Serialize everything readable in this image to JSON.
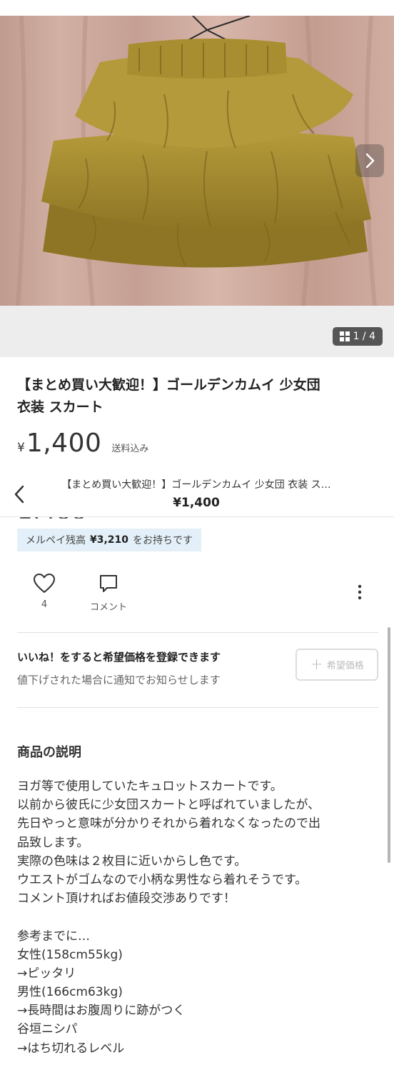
{
  "photo": {
    "counter": "1 / 4",
    "next_icon": "chevron-right-icon",
    "gallery_icon": "grid-icon"
  },
  "item": {
    "title_line1": "【まとめ買い大歓迎！】ゴールデンカムイ 少女団",
    "title_line2": "衣装 スカート",
    "currency": "¥",
    "price": "1,400",
    "shipping": "送料込み"
  },
  "sticky_header": {
    "title": "【まとめ買い大歓迎！】ゴールデンカムイ 少女団 衣装 ス…",
    "price": "¥1,400",
    "back_icon": "chevron-left-icon"
  },
  "balance": {
    "label": "メルペイ残高",
    "amount": "¥3,210",
    "suffix": "をお持ちです"
  },
  "actions": {
    "like_count": "4",
    "comment_label": "コメント"
  },
  "like_promo": {
    "heading": "いいね！をすると希望価格を登録できます",
    "subtext": "値下げされた場合に通知でお知らせします",
    "button_label": "希望価格"
  },
  "description": {
    "heading": "商品の説明",
    "lines": [
      "ヨガ等で使用していたキュロットスカートです。",
      "以前から彼氏に少女団スカートと呼ばれていましたが、",
      "先日やっと意味が分かりそれから着れなくなったので出",
      "品致します。",
      "実際の色味は２枚目に近いからし色です。",
      "ウエストがゴムなので小柄な男性なら着れそうです。",
      "コメント頂ければお値段交渉ありです！",
      "",
      "参考までに…",
      "女性(158cm55kg)",
      "→ピッタリ",
      "男性(166cm63kg)",
      "→長時間はお腹周りに跡がつく",
      "谷垣ニシパ",
      "→はち切れるレベル"
    ]
  },
  "colors": {
    "skirt": "#a38a2c",
    "curtain": "#c9a297",
    "balance_bg": "#e3f0f9"
  }
}
